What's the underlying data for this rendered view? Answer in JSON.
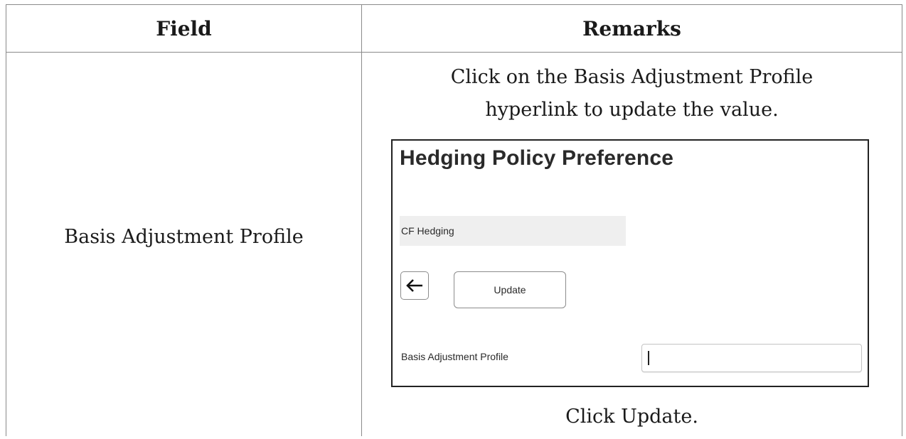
{
  "table": {
    "headers": {
      "field": "Field",
      "remarks": "Remarks"
    },
    "row": {
      "field": "Basis Adjustment Profile",
      "remark_intro_line1": "Click on the Basis Adjustment Profile",
      "remark_intro_line2": "hyperlink to update the value.",
      "remark_outro": "Click Update."
    }
  },
  "screenshot": {
    "title": "Hedging Policy Preference",
    "record_name": "CF Hedging",
    "back_icon": "arrow-left-icon",
    "update_label": "Update",
    "field_label": "Basis Adjustment Profile",
    "field_value": ""
  }
}
